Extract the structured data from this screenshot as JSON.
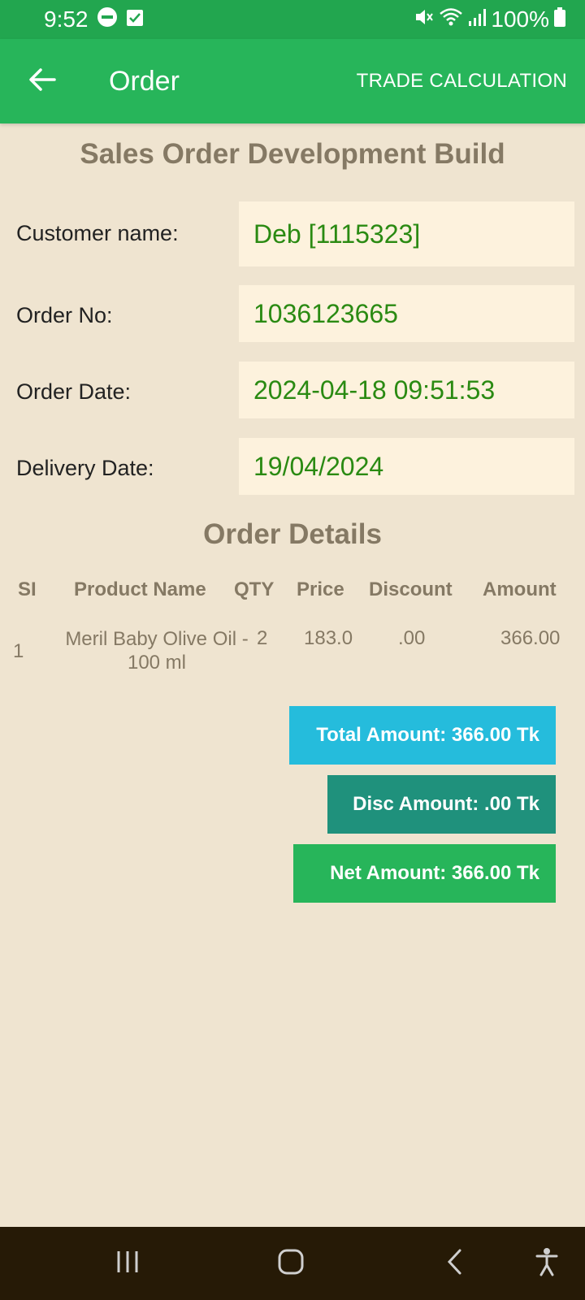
{
  "status_bar": {
    "time": "9:52",
    "battery": "100%",
    "icons": [
      "dnd-icon",
      "check-box-icon",
      "mute-icon",
      "wifi-icon",
      "signal-icon",
      "battery-icon"
    ]
  },
  "app_bar": {
    "title": "Order",
    "trade_button": "TRADE CALCULATION"
  },
  "page_title": "Sales Order Development Build",
  "fields": {
    "customer_label": "Customer name:",
    "customer_value": "Deb [1115323]",
    "order_no_label": "Order No:",
    "order_no_value": "1036123665",
    "order_date_label": "Order Date:",
    "order_date_value": "2024-04-18 09:51:53",
    "delivery_date_label": "Delivery Date:",
    "delivery_date_value": "19/04/2024"
  },
  "details_title": "Order Details",
  "table": {
    "headers": [
      "SI",
      "Product Name",
      "QTY",
      "Price",
      "Discount",
      "Amount"
    ],
    "rows": [
      {
        "si": "1",
        "name": "Meril Baby Olive Oil - 100 ml",
        "qty": "2",
        "price": "183.0",
        "discount": ".00",
        "amount": "366.00"
      }
    ]
  },
  "summary": {
    "total": "Total Amount: 366.00 Tk",
    "disc": "Disc Amount: .00 Tk",
    "net": "Net Amount: 366.00 Tk"
  },
  "colors": {
    "status_bar": "#22a64f",
    "app_bar": "#27b55a",
    "background": "#efe4d0",
    "value_box": "#fdf2dd",
    "value_text": "#2a8a12",
    "total_btn": "#25bcdc",
    "disc_btn": "#1f917c",
    "net_btn": "#27b55a",
    "nav_bar": "#261a06"
  }
}
